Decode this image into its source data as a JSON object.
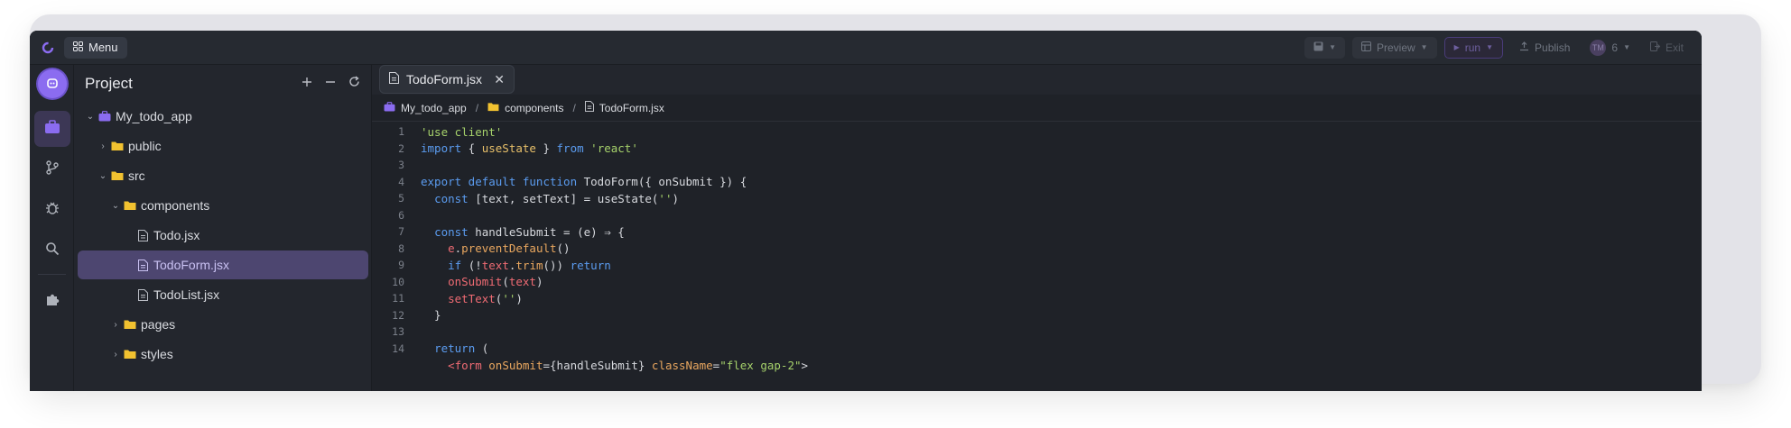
{
  "topbar": {
    "menu_label": "Menu",
    "preview_label": "Preview",
    "run_label": "run",
    "publish_label": "Publish",
    "user_initials": "TM",
    "user_count": "6",
    "exit_label": "Exit"
  },
  "sidebar": {
    "title": "Project",
    "tree": [
      {
        "label": "My_todo_app",
        "type": "project",
        "expanded": true
      },
      {
        "label": "public",
        "type": "folder",
        "expanded": false
      },
      {
        "label": "src",
        "type": "folder",
        "expanded": true
      },
      {
        "label": "components",
        "type": "folder",
        "expanded": true
      },
      {
        "label": "Todo.jsx",
        "type": "file"
      },
      {
        "label": "TodoForm.jsx",
        "type": "file",
        "selected": true
      },
      {
        "label": "TodoList.jsx",
        "type": "file"
      },
      {
        "label": "pages",
        "type": "folder",
        "expanded": false
      },
      {
        "label": "styles",
        "type": "folder",
        "expanded": false
      }
    ]
  },
  "editor": {
    "tab_label": "TodoForm.jsx",
    "breadcrumb": [
      "My_todo_app",
      "components",
      "TodoForm.jsx"
    ],
    "line_numbers": [
      "1",
      "2",
      "3",
      "4",
      "5",
      "6",
      "7",
      "8",
      "9",
      "10",
      "11",
      "12",
      "13",
      "14"
    ]
  },
  "colors": {
    "accent": "#8b6cf0",
    "selection": "#4d4670",
    "folder": "#f2c230",
    "keyword": "#5b9cf0",
    "string": "#a6d26b",
    "variable": "#ef6b73",
    "method": "#e9a75f"
  }
}
